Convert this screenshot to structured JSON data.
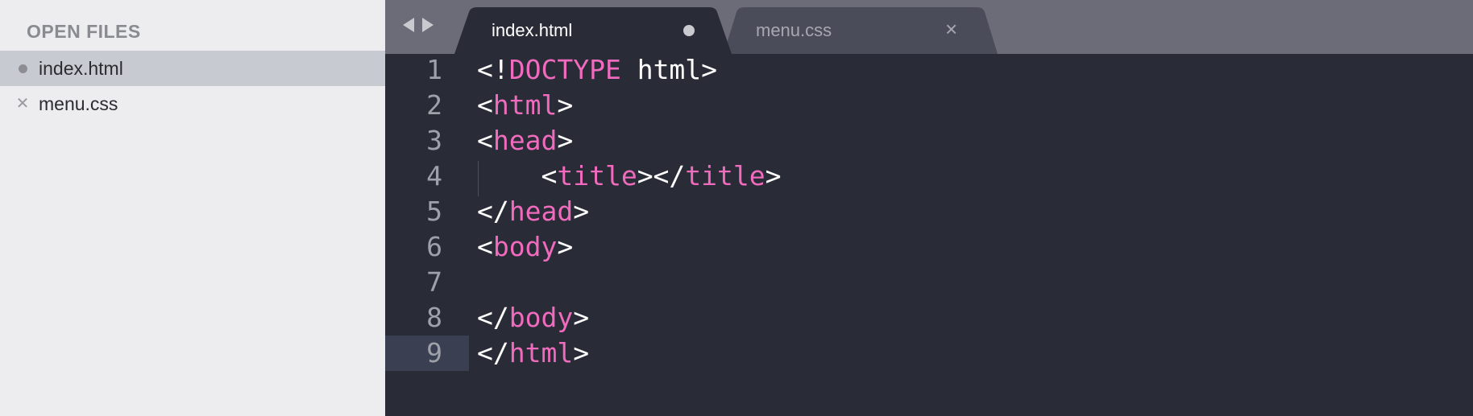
{
  "sidebar": {
    "header": "OPEN FILES",
    "files": [
      {
        "name": "index.html",
        "state": "modified",
        "active": true
      },
      {
        "name": "menu.css",
        "state": "closeable",
        "active": false
      }
    ]
  },
  "tabs": [
    {
      "label": "index.html",
      "active": true,
      "control": "modified-dot"
    },
    {
      "label": "menu.css",
      "active": false,
      "control": "×"
    }
  ],
  "editor": {
    "current_line": 9,
    "lines": [
      {
        "num": "1",
        "parts": [
          {
            "t": "<!",
            "k": "punct"
          },
          {
            "t": "DOCTYPE",
            "k": "tag"
          },
          {
            "t": " html>",
            "k": "punct"
          }
        ]
      },
      {
        "num": "2",
        "parts": [
          {
            "t": "<",
            "k": "punct"
          },
          {
            "t": "html",
            "k": "tag"
          },
          {
            "t": ">",
            "k": "punct"
          }
        ]
      },
      {
        "num": "3",
        "parts": [
          {
            "t": "<",
            "k": "punct"
          },
          {
            "t": "head",
            "k": "tag"
          },
          {
            "t": ">",
            "k": "punct"
          }
        ]
      },
      {
        "num": "4",
        "parts": [
          {
            "t": "    <",
            "k": "punct"
          },
          {
            "t": "title",
            "k": "tag"
          },
          {
            "t": "></",
            "k": "punct"
          },
          {
            "t": "title",
            "k": "tag"
          },
          {
            "t": ">",
            "k": "punct"
          }
        ]
      },
      {
        "num": "5",
        "parts": [
          {
            "t": "</",
            "k": "punct"
          },
          {
            "t": "head",
            "k": "tag"
          },
          {
            "t": ">",
            "k": "punct"
          }
        ]
      },
      {
        "num": "6",
        "parts": [
          {
            "t": "<",
            "k": "punct"
          },
          {
            "t": "body",
            "k": "tag"
          },
          {
            "t": ">",
            "k": "punct"
          }
        ]
      },
      {
        "num": "7",
        "parts": []
      },
      {
        "num": "8",
        "parts": [
          {
            "t": "</",
            "k": "punct"
          },
          {
            "t": "body",
            "k": "tag"
          },
          {
            "t": ">",
            "k": "punct"
          }
        ]
      },
      {
        "num": "9",
        "parts": [
          {
            "t": "</",
            "k": "punct"
          },
          {
            "t": "html",
            "k": "tag"
          },
          {
            "t": ">",
            "k": "punct"
          }
        ]
      }
    ]
  },
  "colors": {
    "sidebar_bg": "#ededef",
    "sidebar_active": "#c8cad1",
    "tabbar_bg": "#6b6c78",
    "editor_bg": "#292b37",
    "inactive_tab_bg": "#4b4c59",
    "tag": "#f06bbd",
    "text": "#ffffff",
    "line_number": "#9fa1aa",
    "current_line": "#3b3f52"
  }
}
